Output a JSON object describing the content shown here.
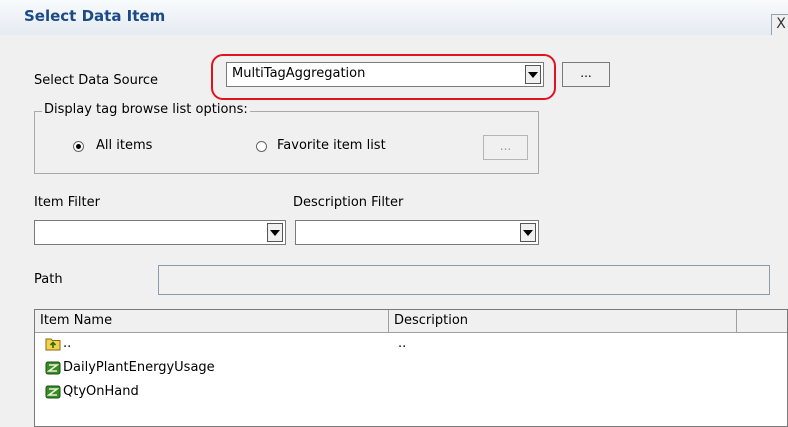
{
  "dialog": {
    "title": "Select Data Item",
    "close_glyph": "X"
  },
  "data_source": {
    "label": "Select Data Source",
    "value": "MultiTagAggregation",
    "browse_label": "..."
  },
  "display_options": {
    "legend": "Display tag browse list options:",
    "all_items_label": "All items",
    "favorite_label": "Favorite item list",
    "favorite_browse_label": "...",
    "selected": "All items"
  },
  "filters": {
    "item_filter_label": "Item Filter",
    "item_filter_value": "",
    "description_filter_label": "Description Filter",
    "description_filter_value": ""
  },
  "path": {
    "label": "Path",
    "value": ""
  },
  "list": {
    "columns": [
      "Item Name",
      "Description"
    ],
    "rows": [
      {
        "name": "..",
        "description": "..",
        "icon": "folder-up-icon"
      },
      {
        "name": "DailyPlantEnergyUsage",
        "description": "",
        "icon": "tag-icon"
      },
      {
        "name": "QtyOnHand",
        "description": "",
        "icon": "tag-icon"
      }
    ]
  },
  "colors": {
    "title_text": "#1b4a86",
    "highlight_ring": "#e2121e",
    "dialog_bg": "#f0f0f0"
  }
}
